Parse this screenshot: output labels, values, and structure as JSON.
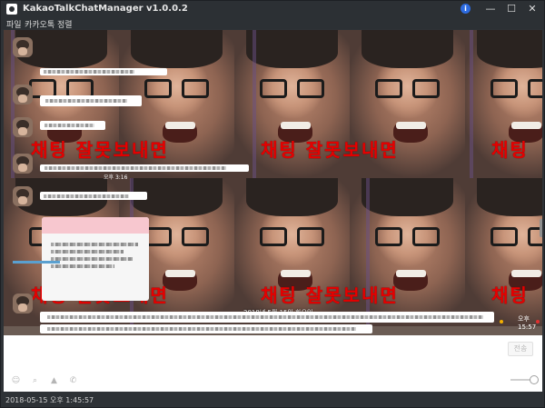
{
  "window": {
    "title": "KakaoTalkChatManager v1.0.0.2"
  },
  "menu": {
    "items": [
      "파일",
      "카카오톡",
      "정렬"
    ]
  },
  "chat": {
    "meme_text": "채팅 잘못보내면",
    "meme_text_short": "채팅",
    "date_divider": "2018년 5월 15일 화요일",
    "time_snippet": "오후 3:16",
    "badge": "오후 15:57"
  },
  "input": {
    "send_label": "전송"
  },
  "status": {
    "timestamp": "2018-05-15 오후 1:45:57"
  },
  "colors": {
    "meme_red": "#e60000",
    "link_blue": "#5aa0d0",
    "card_pink": "#f7c7cf"
  }
}
